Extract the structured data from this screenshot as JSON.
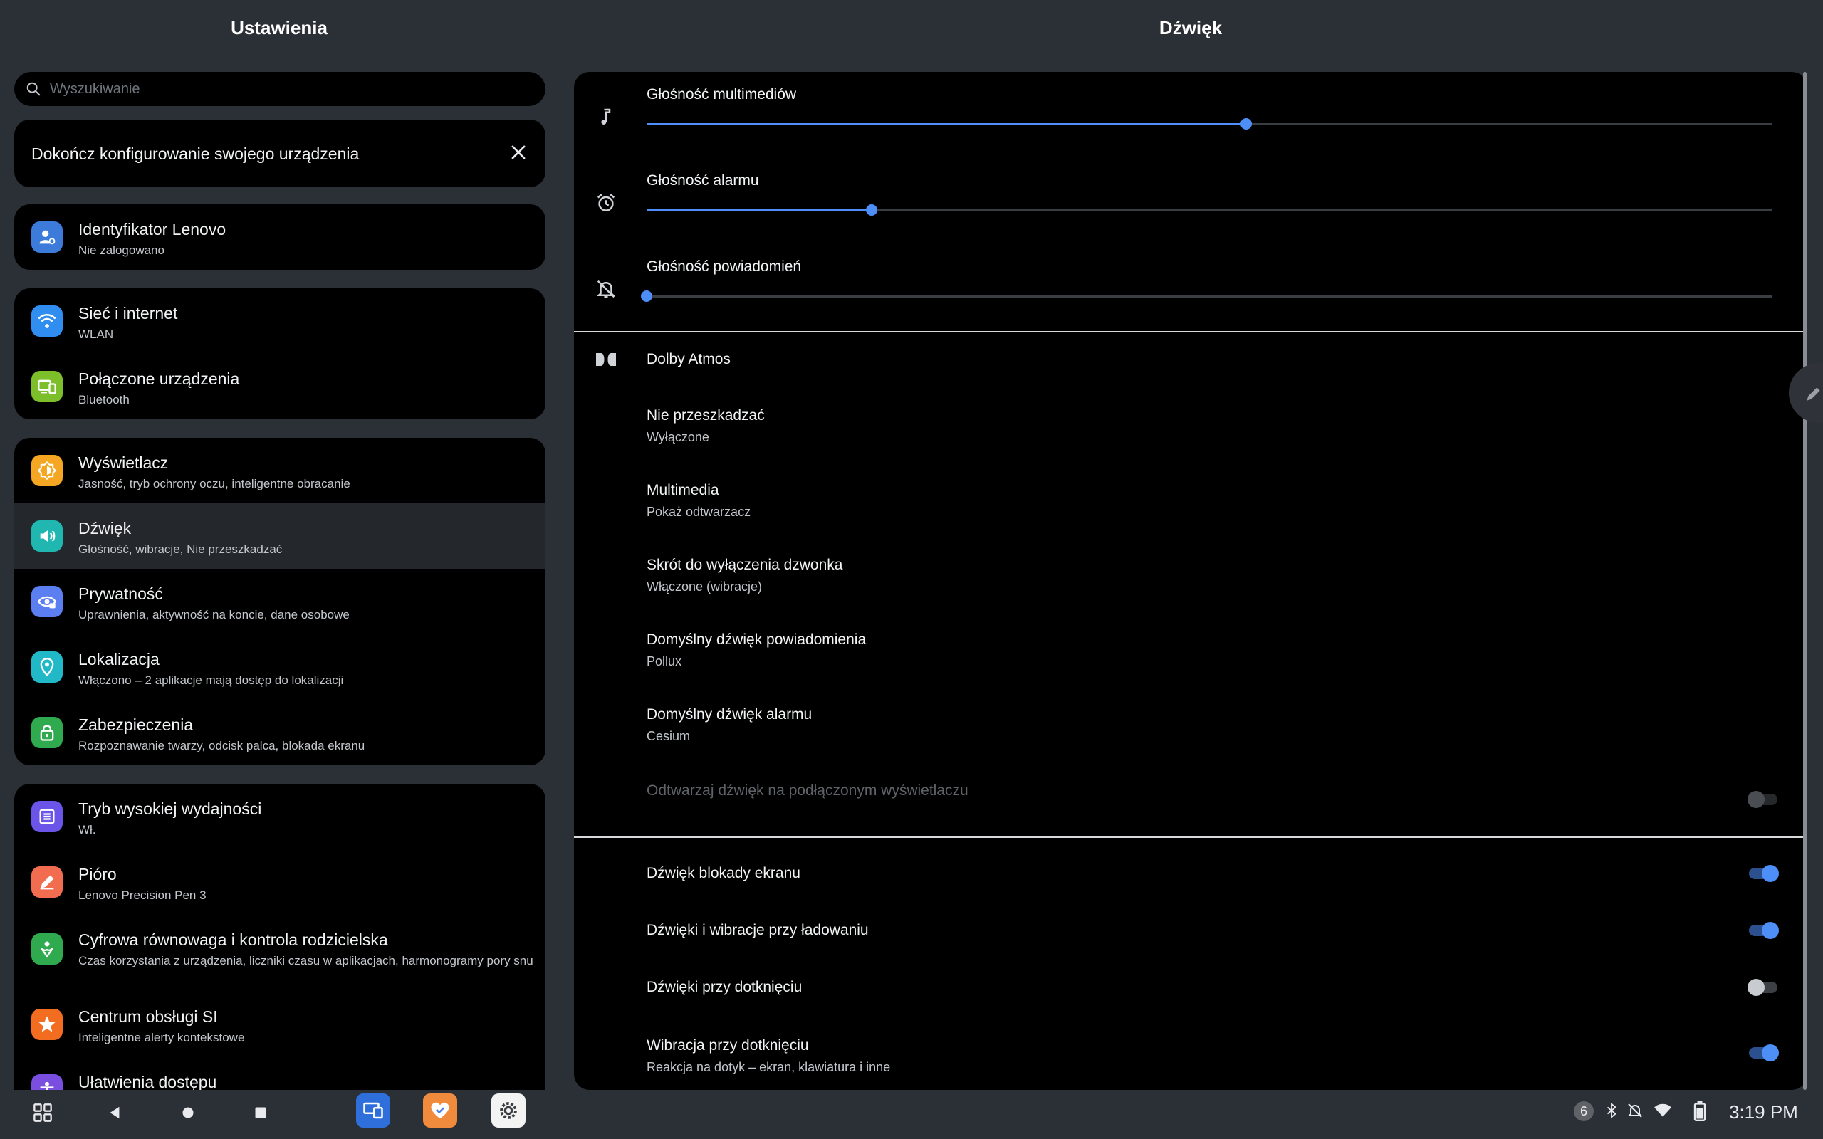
{
  "header": {
    "left_title": "Ustawienia",
    "right_title": "Dźwięk"
  },
  "search": {
    "placeholder": "Wyszukiwanie"
  },
  "setup_card": {
    "text": "Dokończ konfigurowanie swojego urządzenia"
  },
  "settings": {
    "lenovo_id": {
      "title": "Identyfikator Lenovo",
      "subtitle": "Nie zalogowano",
      "color": "#3c7bd9"
    },
    "network": {
      "title": "Sieć i internet",
      "subtitle": "WLAN",
      "color": "#2f8ef0"
    },
    "connected": {
      "title": "Połączone urządzenia",
      "subtitle": "Bluetooth",
      "color": "#7dbf2a"
    },
    "display": {
      "title": "Wyświetlacz",
      "subtitle": "Jasność, tryb ochrony oczu, inteligentne obracanie",
      "color": "#f5a623"
    },
    "sound": {
      "title": "Dźwięk",
      "subtitle": "Głośność, wibracje, Nie przeszkadzać",
      "color": "#20b7b0"
    },
    "privacy": {
      "title": "Prywatność",
      "subtitle": "Uprawnienia, aktywność na koncie, dane osobowe",
      "color": "#5b7ff0"
    },
    "location": {
      "title": "Lokalizacja",
      "subtitle": "Włączono – 2 aplikacje mają dostęp do lokalizacji",
      "color": "#21b8c8"
    },
    "security": {
      "title": "Zabezpieczenia",
      "subtitle": "Rozpoznawanie twarzy, odcisk palca, blokada ekranu",
      "color": "#2faa4f"
    },
    "performance": {
      "title": "Tryb wysokiej wydajności",
      "subtitle": "Wł.",
      "color": "#6a55e8"
    },
    "pen": {
      "title": "Pióro",
      "subtitle": "Lenovo Precision Pen 3",
      "color": "#f26d4f"
    },
    "wellbeing": {
      "title": "Cyfrowa równowaga i kontrola rodzicielska",
      "subtitle": "Czas korzystania z urządzenia, liczniki czasu w aplikacjach, harmonogramy pory snu",
      "color": "#2faa4f"
    },
    "ai_center": {
      "title": "Centrum obsługi SI",
      "subtitle": "Inteligentne alerty kontekstowe",
      "color": "#f26d1f"
    },
    "accessibility": {
      "title": "Ułatwienia dostępu",
      "color": "#7a4fe0"
    }
  },
  "sound": {
    "media_volume": {
      "label": "Głośność multimediów",
      "level": 0.533
    },
    "alarm_volume": {
      "label": "Głośność alarmu",
      "level": 0.2
    },
    "notif_volume": {
      "label": "Głośność powiadomień",
      "level": 0.0
    },
    "dolby": {
      "label": "Dolby Atmos"
    },
    "dnd": {
      "title": "Nie przeszkadzać",
      "subtitle": "Wyłączone"
    },
    "media": {
      "title": "Multimedia",
      "subtitle": "Pokaż odtwarzacz"
    },
    "ring_shortcut": {
      "title": "Skrót do wyłączenia dzwonka",
      "subtitle": "Włączone (wibracje)"
    },
    "default_notif": {
      "title": "Domyślny dźwięk powiadomienia",
      "subtitle": "Pollux"
    },
    "default_alarm": {
      "title": "Domyślny dźwięk alarmu",
      "subtitle": "Cesium"
    },
    "play_connected": {
      "title": "Odtwarzaj dźwięk na podłączonym wyświetlaczu",
      "enabled": false,
      "on": false
    },
    "lock_sound": {
      "title": "Dźwięk blokady ekranu",
      "on": true
    },
    "charging_sound": {
      "title": "Dźwięki i wibracje przy ładowaniu",
      "on": true
    },
    "touch_sound": {
      "title": "Dźwięki przy dotknięciu",
      "on": false
    },
    "touch_vibration": {
      "title": "Wibracja przy dotknięciu",
      "subtitle": "Reakcja na dotyk – ekran, klawiatura i inne",
      "on": true
    }
  },
  "statusbar": {
    "notif_count": "6",
    "time": "3:19 PM"
  },
  "accent": "#4d8ef7"
}
